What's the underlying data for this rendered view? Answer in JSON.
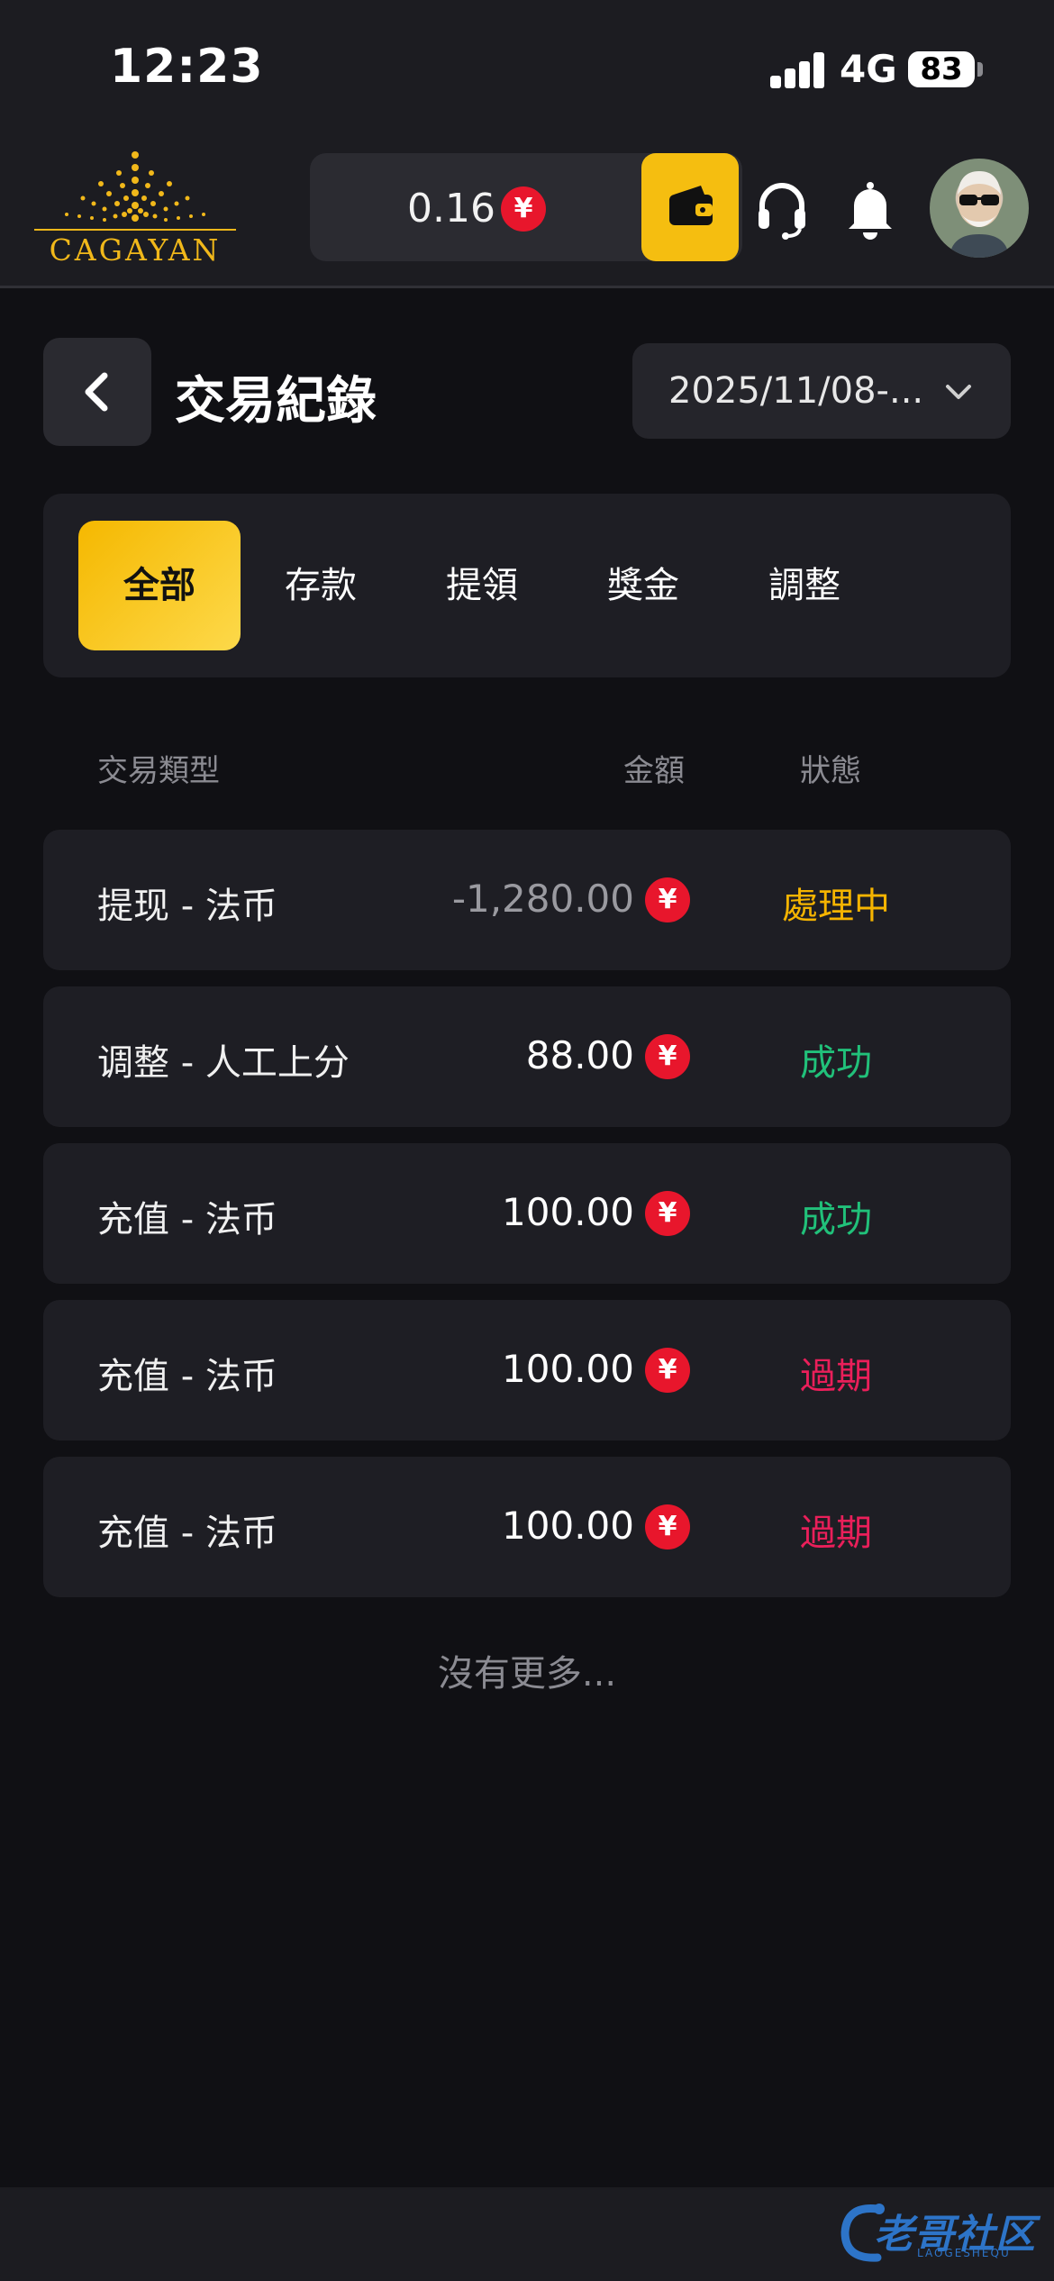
{
  "status_bar": {
    "time": "12:23",
    "network": "4G",
    "battery": "83"
  },
  "header": {
    "logo_text": "CAGAYAN",
    "balance": "0.16",
    "currency_symbol": "¥"
  },
  "page": {
    "title": "交易紀錄",
    "date_filter": "2025/11/08-..."
  },
  "tabs": [
    {
      "label": "全部",
      "active": true
    },
    {
      "label": "存款",
      "active": false
    },
    {
      "label": "提領",
      "active": false
    },
    {
      "label": "獎金",
      "active": false
    },
    {
      "label": "調整",
      "active": false
    }
  ],
  "table": {
    "headers": {
      "type": "交易類型",
      "amount": "金額",
      "status": "狀態"
    },
    "rows": [
      {
        "type": "提现 - 法币",
        "amount": "-1,280.00",
        "status": "處理中",
        "status_color": "#f5b400",
        "amount_color": "#9a9aa0"
      },
      {
        "type": "调整 - 人工上分",
        "amount": "88.00",
        "status": "成功",
        "status_color": "#21c17a",
        "amount_color": "#ffffff"
      },
      {
        "type": "充值 - 法币",
        "amount": "100.00",
        "status": "成功",
        "status_color": "#21c17a",
        "amount_color": "#ffffff"
      },
      {
        "type": "充值 - 法币",
        "amount": "100.00",
        "status": "過期",
        "status_color": "#ea1f5a",
        "amount_color": "#ffffff"
      },
      {
        "type": "充值 - 法币",
        "amount": "100.00",
        "status": "過期",
        "status_color": "#ea1f5a",
        "amount_color": "#ffffff"
      }
    ]
  },
  "footer": {
    "no_more": "沒有更多..."
  },
  "watermark": {
    "text": "老哥社区",
    "sub": "LAOGESHEQU"
  },
  "colors": {
    "accent": "#f5be10",
    "background": "#101014",
    "panel": "#1e1e24",
    "coin": "#e8162c"
  }
}
